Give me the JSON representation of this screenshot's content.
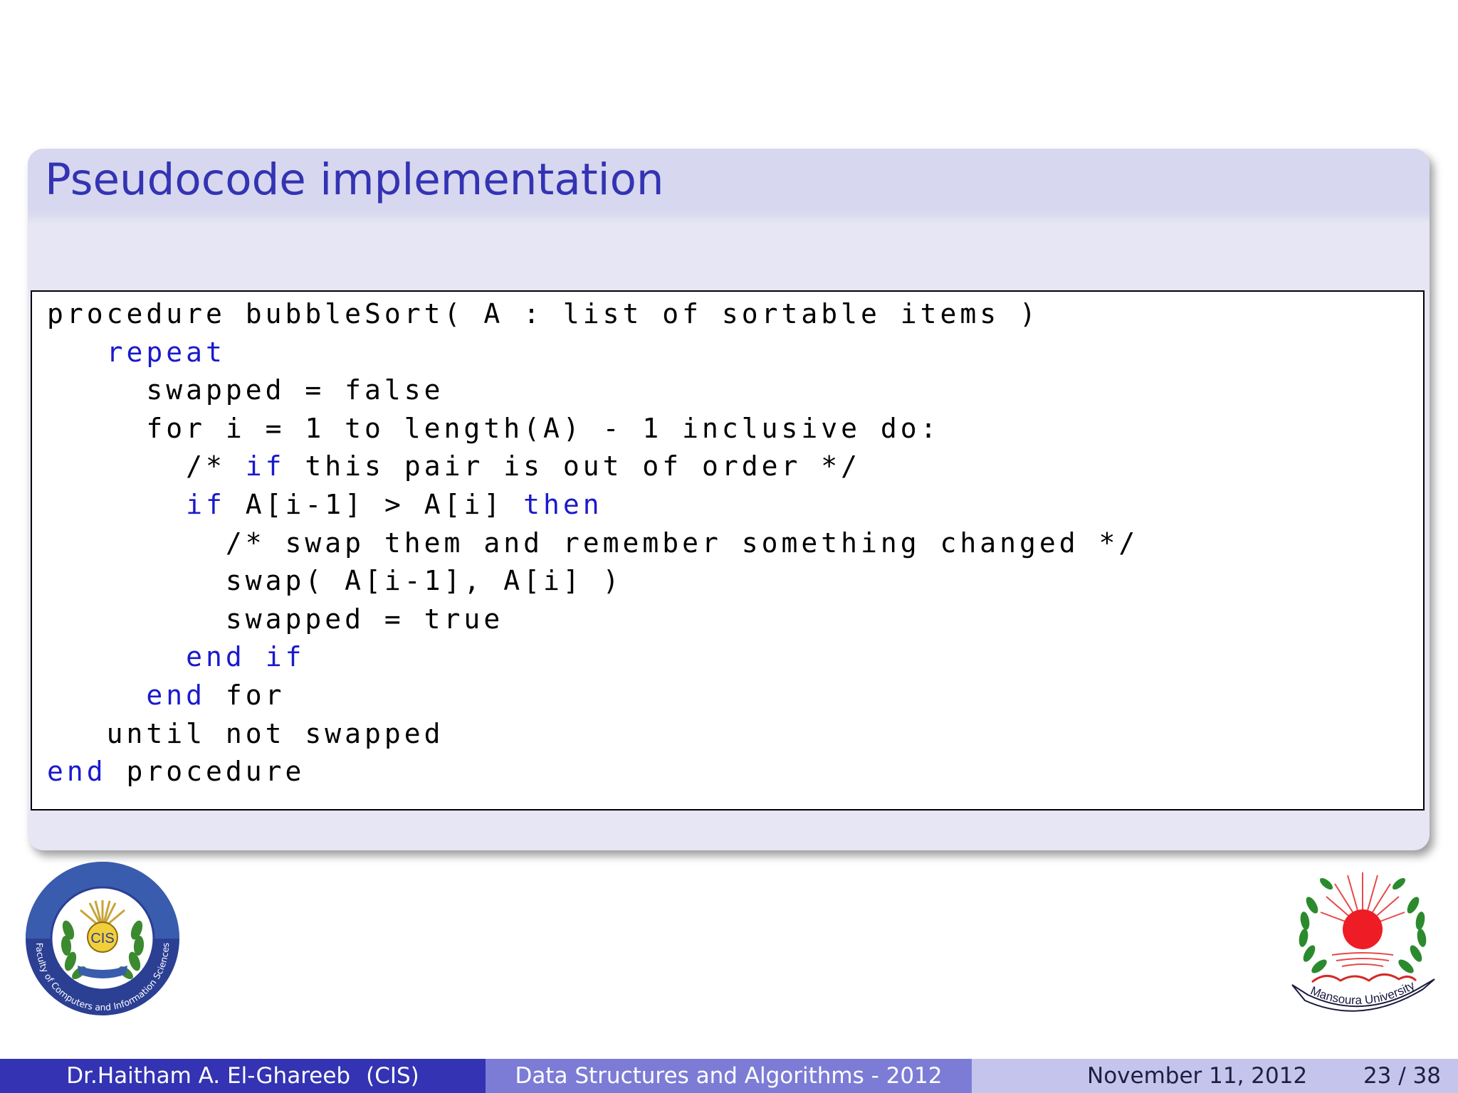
{
  "block": {
    "title": "Pseudocode implementation"
  },
  "code": {
    "lines": [
      [
        {
          "t": "procedure bubbleSort( A : list of sortable items )",
          "kw": false
        }
      ],
      [
        {
          "t": "   ",
          "kw": false
        },
        {
          "t": "repeat",
          "kw": true
        }
      ],
      [
        {
          "t": "     swapped = false",
          "kw": false
        }
      ],
      [
        {
          "t": "     for i = 1 to length(A) - 1 inclusive do:",
          "kw": false
        }
      ],
      [
        {
          "t": "       /* ",
          "kw": false
        },
        {
          "t": "if",
          "kw": true
        },
        {
          "t": " this pair is out of order */",
          "kw": false
        }
      ],
      [
        {
          "t": "       ",
          "kw": false
        },
        {
          "t": "if",
          "kw": true
        },
        {
          "t": " A[i-1] > A[i] ",
          "kw": false
        },
        {
          "t": "then",
          "kw": true
        }
      ],
      [
        {
          "t": "         /* swap them and remember something changed */",
          "kw": false
        }
      ],
      [
        {
          "t": "         swap( A[i-1], A[i] )",
          "kw": false
        }
      ],
      [
        {
          "t": "         swapped = true",
          "kw": false
        }
      ],
      [
        {
          "t": "       ",
          "kw": false
        },
        {
          "t": "end",
          "kw": true
        },
        {
          "t": " ",
          "kw": false
        },
        {
          "t": "if",
          "kw": true
        }
      ],
      [
        {
          "t": "     ",
          "kw": false
        },
        {
          "t": "end",
          "kw": true
        },
        {
          "t": " for",
          "kw": false
        }
      ],
      [
        {
          "t": "   until not swapped",
          "kw": false
        }
      ],
      [
        {
          "t": "end",
          "kw": true
        },
        {
          "t": " procedure",
          "kw": false
        }
      ]
    ],
    "keyword_color": "#1a1acc",
    "text_color": "#000000"
  },
  "logos": {
    "left": {
      "icon": "cis-faculty-logo",
      "text": "Faculty of Computers and Information Sciences",
      "badge": "CIS"
    },
    "right": {
      "icon": "mansoura-university-logo",
      "text": "Mansoura University"
    }
  },
  "footer": {
    "author": "Dr.Haitham A. El-Ghareeb",
    "affiliation": "(CIS)",
    "course": "Data Structures and Algorithms - 2012",
    "date": "November 11, 2012",
    "page": "23 / 38"
  },
  "colors": {
    "title": "#3333b3",
    "block_title_bg": "#d7d7ef",
    "block_body_bg": "#e6e6f4",
    "footer_left_bg": "#3333b3",
    "footer_center_bg": "#7c7cd6",
    "footer_right_bg": "#c4c4ec"
  }
}
